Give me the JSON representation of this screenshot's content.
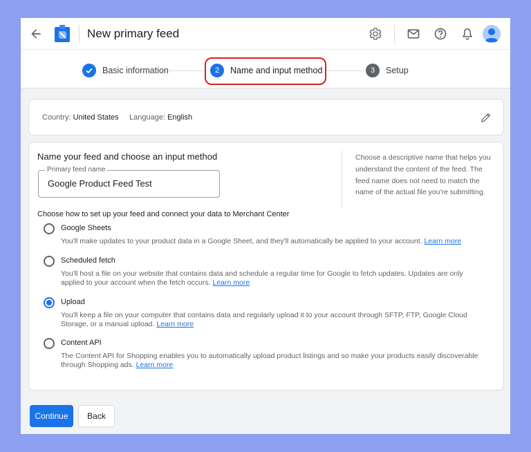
{
  "header": {
    "title": "New primary feed",
    "icons": [
      "back-arrow-icon",
      "merchant-center-logo",
      "settings-icon",
      "mail-icon",
      "help-icon",
      "notifications-icon",
      "account-avatar"
    ]
  },
  "stepper": {
    "steps": [
      {
        "number": "",
        "label": "Basic information",
        "state": "completed"
      },
      {
        "number": "2",
        "label": "Name and input method",
        "state": "active"
      },
      {
        "number": "3",
        "label": "Setup",
        "state": "upcoming"
      }
    ]
  },
  "summary": {
    "country_label": "Country:",
    "country_value": "United States",
    "language_label": "Language:",
    "language_value": "English"
  },
  "form": {
    "section_title": "Name your feed and choose an input method",
    "feed_name_label": "Primary feed name",
    "feed_name_value": "Google Product Feed Test",
    "help_text": "Choose a descriptive name that helps you understand the content of the feed. The feed name does not need to match the name of the actual file you're submitting.",
    "setup_prompt": "Choose how to set up your feed and connect your data to Merchant Center",
    "options": [
      {
        "title": "Google Sheets",
        "description": "You'll make updates to your product data in a Google Sheet, and they'll automatically be applied to your account.",
        "link": "Learn more",
        "selected": false
      },
      {
        "title": "Scheduled fetch",
        "description": "You'll host a file on your website that contains data and schedule a regular time for Google to fetch updates. Updates are only applied to your account when the fetch occurs.",
        "link": "Learn more",
        "selected": false
      },
      {
        "title": "Upload",
        "description": "You'll keep a file on your computer that contains data and regularly upload it to your account through SFTP, FTP, Google Cloud Storage, or a manual upload.",
        "link": "Learn more",
        "selected": true
      },
      {
        "title": "Content API",
        "description": "The Content API for Shopping enables you to automatically upload product listings and so make your products easily discoverable through Shopping ads.",
        "link": "Learn more",
        "selected": false
      }
    ]
  },
  "actions": {
    "continue_label": "Continue",
    "back_label": "Back"
  },
  "colors": {
    "page_background": "#8c9ff0",
    "accent_blue": "#1a73e8",
    "highlight_red": "#d81f26",
    "step_inactive": "#5f6368"
  }
}
